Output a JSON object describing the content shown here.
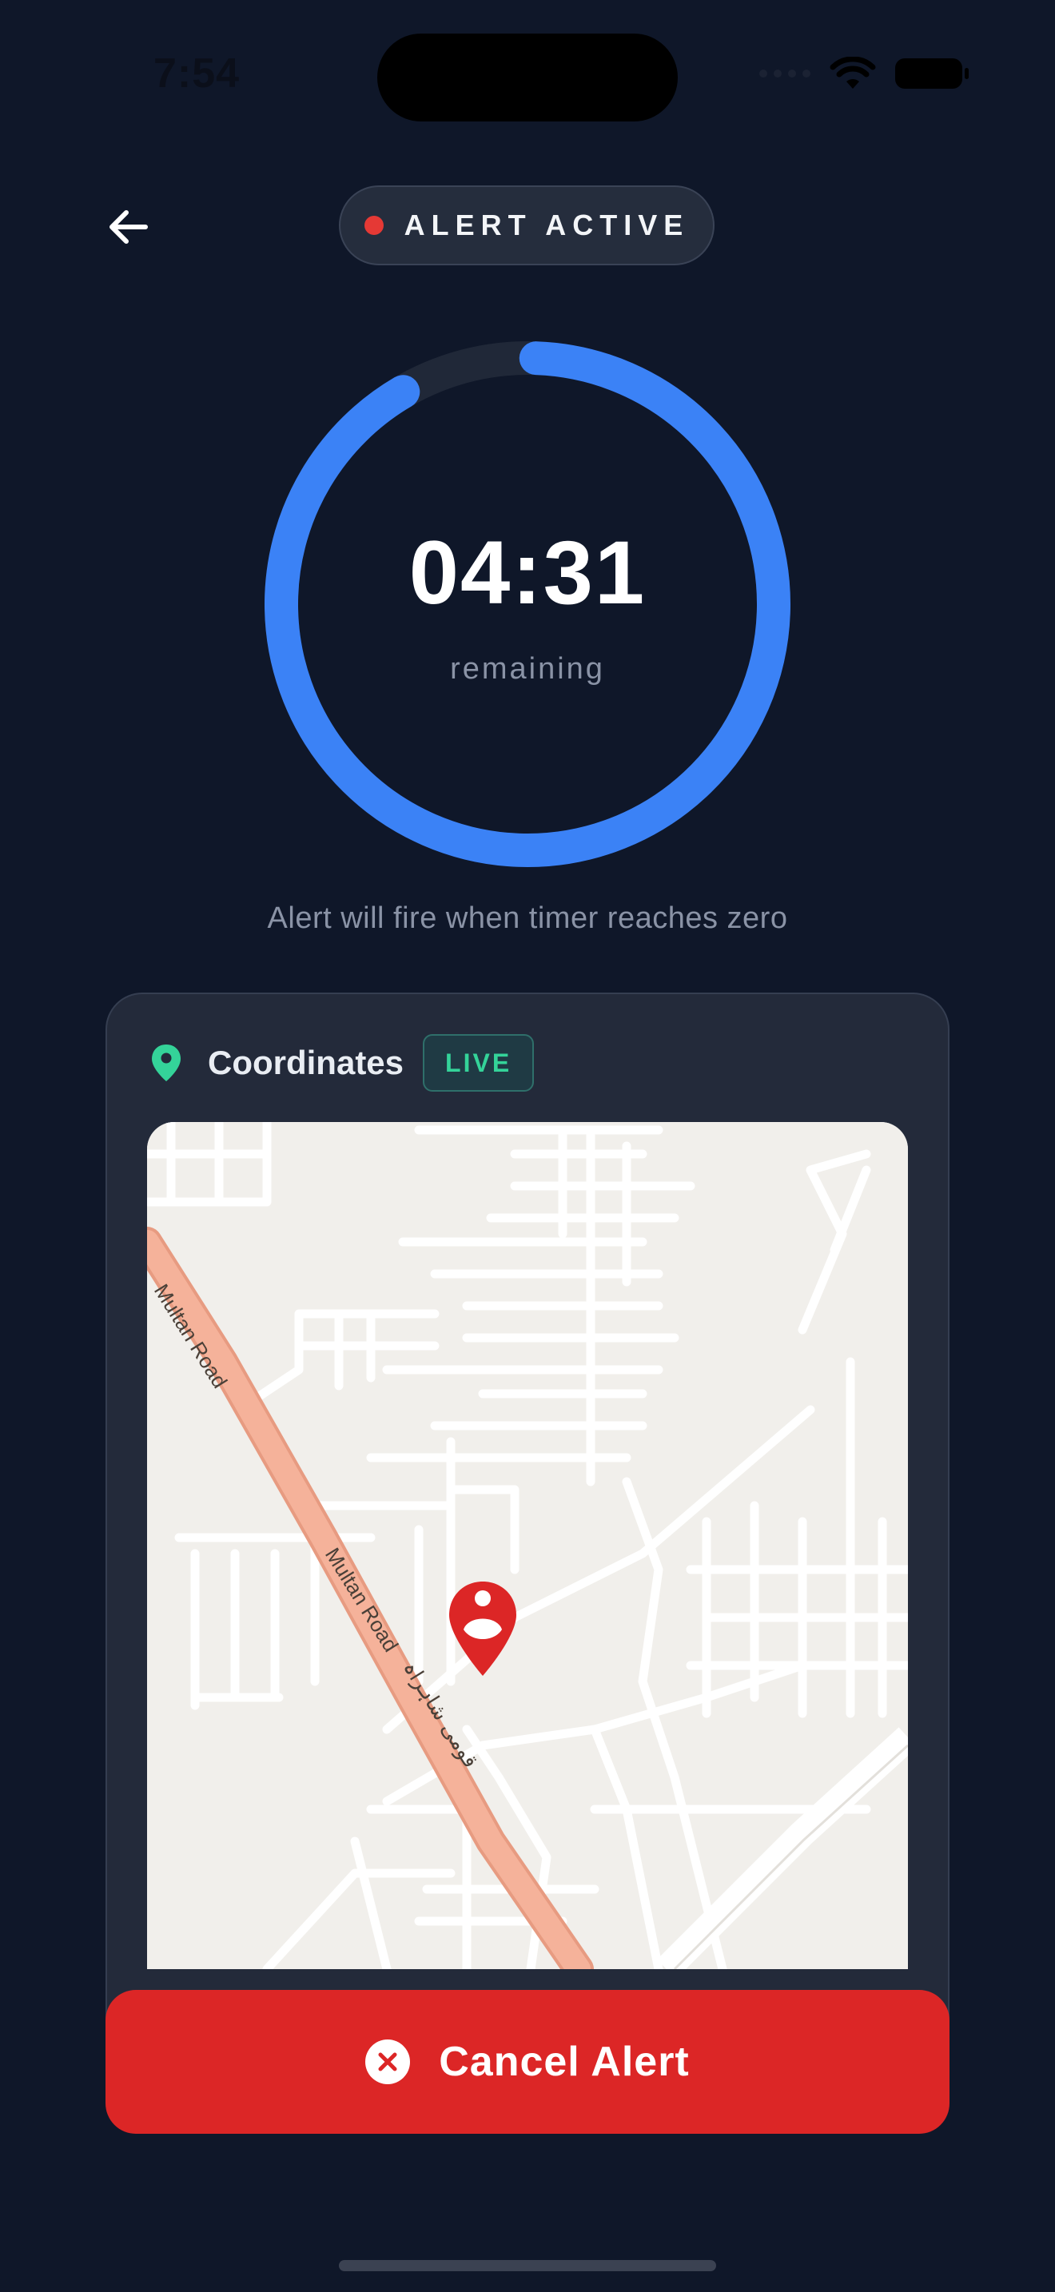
{
  "status_bar": {
    "time": "7:54"
  },
  "header": {
    "status_label": "ALERT ACTIVE",
    "status_color": "#e53935"
  },
  "timer": {
    "value": "04:31",
    "caption": "remaining",
    "progress_fraction": 0.91,
    "ring_color": "#3b82f6"
  },
  "hint": "Alert will fire when timer reaches zero",
  "coordinates_card": {
    "title": "Coordinates",
    "badge": "LIVE",
    "map": {
      "road_labels": [
        "Multan Road",
        "Multan Road",
        "قومی شاہراہ"
      ]
    }
  },
  "actions": {
    "cancel_label": "Cancel Alert",
    "cancel_color": "#dc2626"
  },
  "icons": {
    "back": "arrow-left-icon",
    "location": "map-pin-icon",
    "cancel": "close-circle-icon",
    "marker": "person-pin-icon"
  }
}
